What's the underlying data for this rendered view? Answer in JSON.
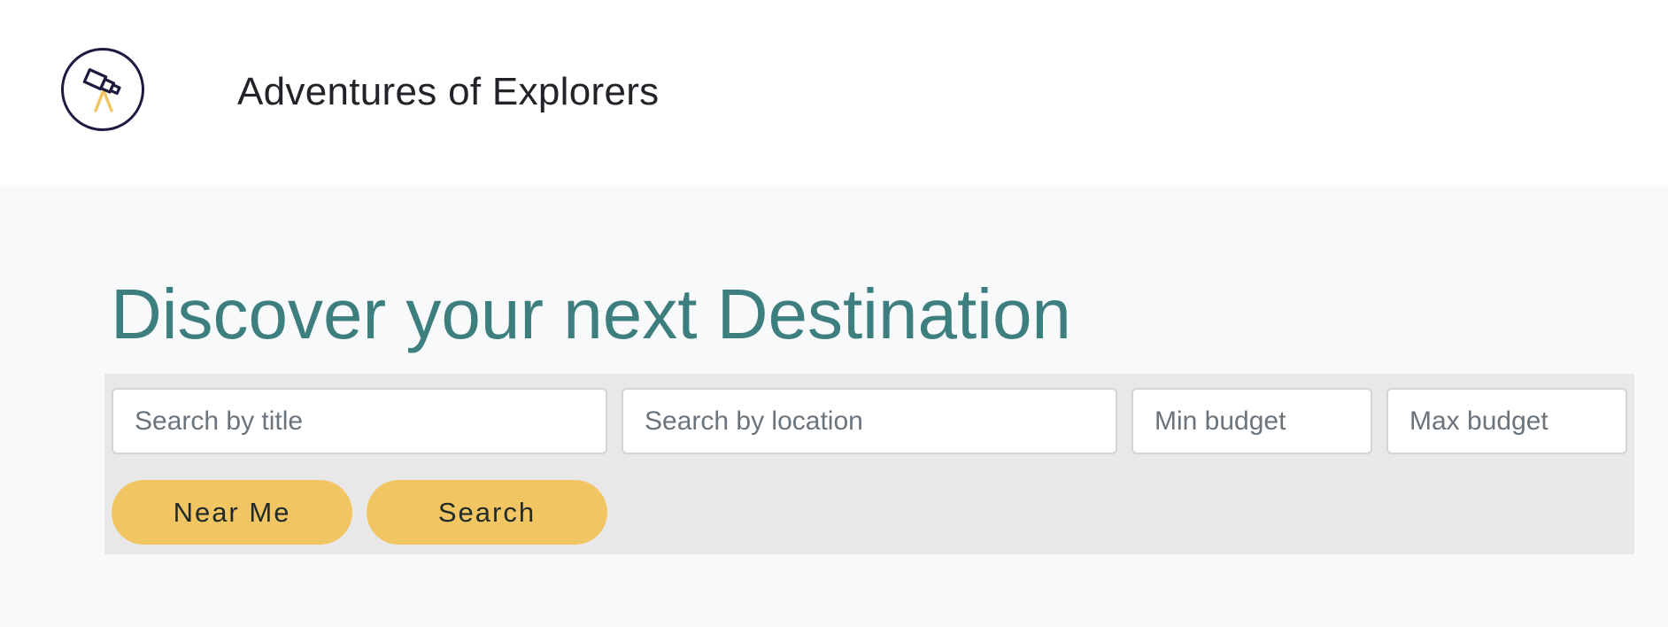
{
  "header": {
    "logo_icon": "telescope-icon",
    "site_title": "Adventures of Explorers"
  },
  "main": {
    "headline": "Discover your next Destination",
    "search": {
      "title_placeholder": "Search by title",
      "location_placeholder": "Search by location",
      "min_budget_placeholder": "Min budget",
      "max_budget_placeholder": "Max budget",
      "near_me_label": "Near Me",
      "search_label": "Search"
    }
  },
  "colors": {
    "headline": "#3d7f7f",
    "button": "#f1c562",
    "panel": "#e8e8e8",
    "page_background": "#f8f9fa",
    "logo_stroke": "#1c1a3f",
    "logo_accent": "#f1c562"
  }
}
